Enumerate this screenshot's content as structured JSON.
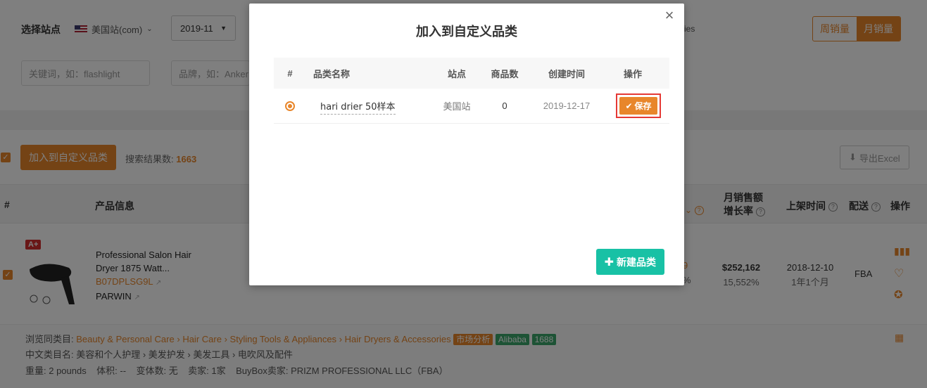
{
  "filters": {
    "site_label": "选择站点",
    "site_value": "美国站(com)",
    "month_value": "2019-11",
    "hidden_fragment": "ies",
    "keyword_placeholder": "关键词，如：flashlight",
    "brand_placeholder": "品牌，如：Anker"
  },
  "sales_toggle": {
    "weekly": "周销量",
    "monthly": "月销量"
  },
  "toolbar": {
    "add_category_label": "加入到自定义品类",
    "result_count_label": "搜索结果数:",
    "result_count": "1663",
    "export_label": "导出Excel"
  },
  "table_header": {
    "index": "#",
    "product_info": "产品信息",
    "monthly_sales_growth": "月销售额增长率",
    "monthly_sales_growth_line1": "月销售额",
    "monthly_sales_growth_line2": "增长率",
    "listed_time": "上架时间",
    "delivery": "配送",
    "actions": "操作"
  },
  "product": {
    "badge": "A+",
    "title_line1": "Professional Salon Hair",
    "title_line2": "Dryer 1875 Watt...",
    "asin": "B07DPLSG9L",
    "brand": "PARWIN",
    "partial_value1": "9",
    "partial_value2": "%",
    "sales_amount": "$252,162",
    "growth_rate": "15,552%",
    "listed_date": "2018-12-10",
    "listed_age": "1年1个月",
    "delivery": "FBA"
  },
  "details": {
    "browse_label": "浏览同类目:",
    "breadcrumb": [
      "Beauty & Personal Care",
      "Hair Care",
      "Styling Tools & Appliances",
      "Hair Dryers & Accessories"
    ],
    "separator": "›",
    "tag_market": "市场分析",
    "tag_alibaba": "Alibaba",
    "tag_1688": "1688",
    "cn_category": "中文类目名: 美容和个人护理 › 美发护发 › 美发工具 › 电吹风及配件",
    "meta": "重量: 2 pounds    体积: --    变体数: 无    卖家: 1家    BuyBox卖家: PRIZM PROFESSIONAL LLC（FBA）"
  },
  "modal": {
    "title": "加入到自定义品类",
    "close_glyph": "×",
    "columns": [
      "#",
      "品类名称",
      "站点",
      "商品数",
      "创建时间",
      "操作"
    ],
    "rows": [
      {
        "name": "hari drier 50样本",
        "site": "美国站",
        "count": "0",
        "created": "2019-12-17",
        "action": "保存"
      }
    ],
    "new_category_label": "新建品类"
  },
  "colors": {
    "accent": "#e8862b",
    "teal": "#18c1a5",
    "highlight": "#e53935"
  }
}
